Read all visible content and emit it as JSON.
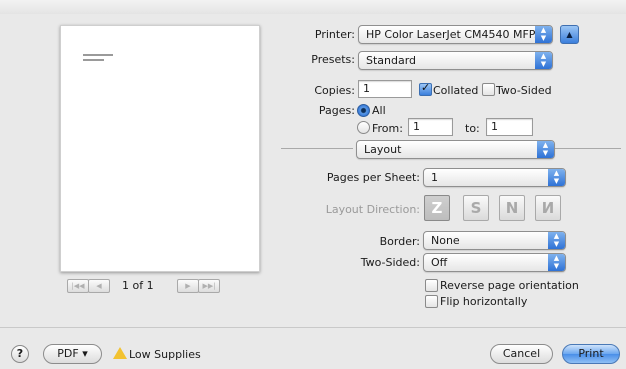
{
  "printer": {
    "label": "Printer:",
    "value": "HP Color LaserJet CM4540 MFP..."
  },
  "presets": {
    "label": "Presets:",
    "value": "Standard"
  },
  "copies": {
    "label": "Copies:",
    "value": "1",
    "collated_label": "Collated",
    "collated_checked": true,
    "two_sided_label": "Two-Sided",
    "two_sided_checked": false
  },
  "pages": {
    "label": "Pages:",
    "all_label": "All",
    "from_label": "From:",
    "from_value": "1",
    "to_label": "to:",
    "to_value": "1",
    "selected": "All"
  },
  "section": {
    "value": "Layout"
  },
  "layout": {
    "pages_per_sheet_label": "Pages per Sheet:",
    "pages_per_sheet_value": "1",
    "direction_label": "Layout Direction:",
    "directions": [
      "Z",
      "S",
      "N",
      "N"
    ],
    "border_label": "Border:",
    "border_value": "None",
    "two_sided_label": "Two-Sided:",
    "two_sided_value": "Off",
    "reverse_label": "Reverse page orientation",
    "reverse_checked": false,
    "flip_label": "Flip horizontally",
    "flip_checked": false
  },
  "preview": {
    "page_indicator": "1 of 1"
  },
  "footer": {
    "help": "?",
    "pdf_label": "PDF ▾",
    "low_supplies_label": "Low Supplies",
    "cancel_label": "Cancel",
    "print_label": "Print"
  },
  "colors": {
    "accent": "#2f72d6",
    "warning": "#f2c230"
  }
}
